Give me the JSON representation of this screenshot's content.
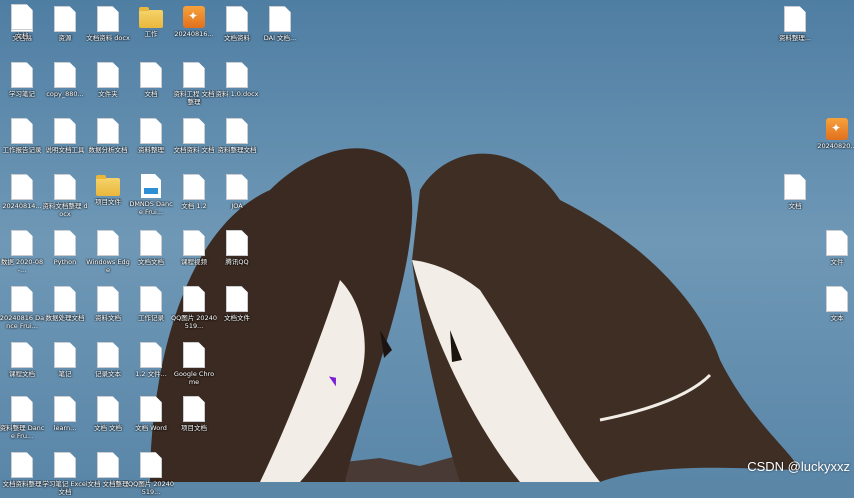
{
  "desktop": {
    "icons": [
      {
        "label": "文档稿",
        "type": "file"
      },
      {
        "label": "学习笔记",
        "type": "file"
      },
      {
        "label": "工作报告记录",
        "type": "file"
      },
      {
        "label": "20240814...",
        "type": "file"
      },
      {
        "label": "数据 2020-08-...",
        "type": "file"
      },
      {
        "label": "20240816 Dance Frui...",
        "type": "file"
      },
      {
        "label": "课程文档",
        "type": "file"
      },
      {
        "label": "资料整理 Dance Fru...",
        "type": "file"
      },
      {
        "label": "文档资料整理",
        "type": "file"
      },
      {
        "label": "资源",
        "type": "file"
      },
      {
        "label": "copy_880...",
        "type": "file"
      },
      {
        "label": "说明文档工具",
        "type": "file"
      },
      {
        "label": "资料文档整理 docx",
        "type": "file"
      },
      {
        "label": "Python",
        "type": "file"
      },
      {
        "label": "数据处理文档",
        "type": "file"
      },
      {
        "label": "笔记",
        "type": "file"
      },
      {
        "label": "learn...",
        "type": "file"
      },
      {
        "label": "学习笔记 Excel文档",
        "type": "file"
      },
      {
        "label": "文档资料 docx",
        "type": "file"
      },
      {
        "label": "文件夹",
        "type": "file"
      },
      {
        "label": "数据分析文档",
        "type": "file"
      },
      {
        "label": "项目文件",
        "type": "folder"
      },
      {
        "label": "Windows Edge",
        "type": "file"
      },
      {
        "label": "资料文档",
        "type": "file"
      },
      {
        "label": "记录文本",
        "type": "file"
      },
      {
        "label": "文档 文档",
        "type": "file"
      },
      {
        "label": "文档 文档整理",
        "type": "file"
      },
      {
        "label": "工作",
        "type": "folder"
      },
      {
        "label": "文档",
        "type": "file"
      },
      {
        "label": "资料整理",
        "type": "file"
      },
      {
        "label": "DMNDS Dance Frui...",
        "type": "media"
      },
      {
        "label": "文档文档",
        "type": "file"
      },
      {
        "label": "工作记录",
        "type": "file"
      },
      {
        "label": "1.2 文件...",
        "type": "file"
      },
      {
        "label": "文档 Word",
        "type": "file"
      },
      {
        "label": "QQ图片 20240519...",
        "type": "file"
      },
      {
        "label": "20240816...",
        "type": "app"
      },
      {
        "label": "资料工程 文档整理",
        "type": "file"
      },
      {
        "label": "文档资料 文档",
        "type": "file"
      },
      {
        "label": "文档 1.2",
        "type": "file"
      },
      {
        "label": "课程视频",
        "type": "file"
      },
      {
        "label": "QQ图片 20240519...",
        "type": "file"
      },
      {
        "label": "Google Chrome",
        "type": "file"
      },
      {
        "label": "项目文档",
        "type": "file"
      },
      {
        "label": "文档资料",
        "type": "file"
      },
      {
        "label": "资料 1.0.docx",
        "type": "file"
      },
      {
        "label": "资料整理文档",
        "type": "file"
      },
      {
        "label": "JOA",
        "type": "file"
      },
      {
        "label": "腾讯QQ",
        "type": "file"
      },
      {
        "label": "文档文件",
        "type": "file"
      },
      {
        "label": "DAI 文档...",
        "type": "file"
      },
      {
        "label": "资料整理...",
        "type": "file"
      },
      {
        "label": "20240820...",
        "type": "app"
      },
      {
        "label": "文档",
        "type": "file"
      },
      {
        "label": "文件",
        "type": "file"
      },
      {
        "label": "文本",
        "type": "file"
      },
      {
        "label": "文档",
        "type": "file"
      }
    ]
  },
  "watermark": {
    "text": "CSDN @luckyxxz"
  },
  "colors": {
    "sea": "#5c86a6",
    "bird_dark": "#3a2a22",
    "bird_white": "#f2ede6"
  }
}
